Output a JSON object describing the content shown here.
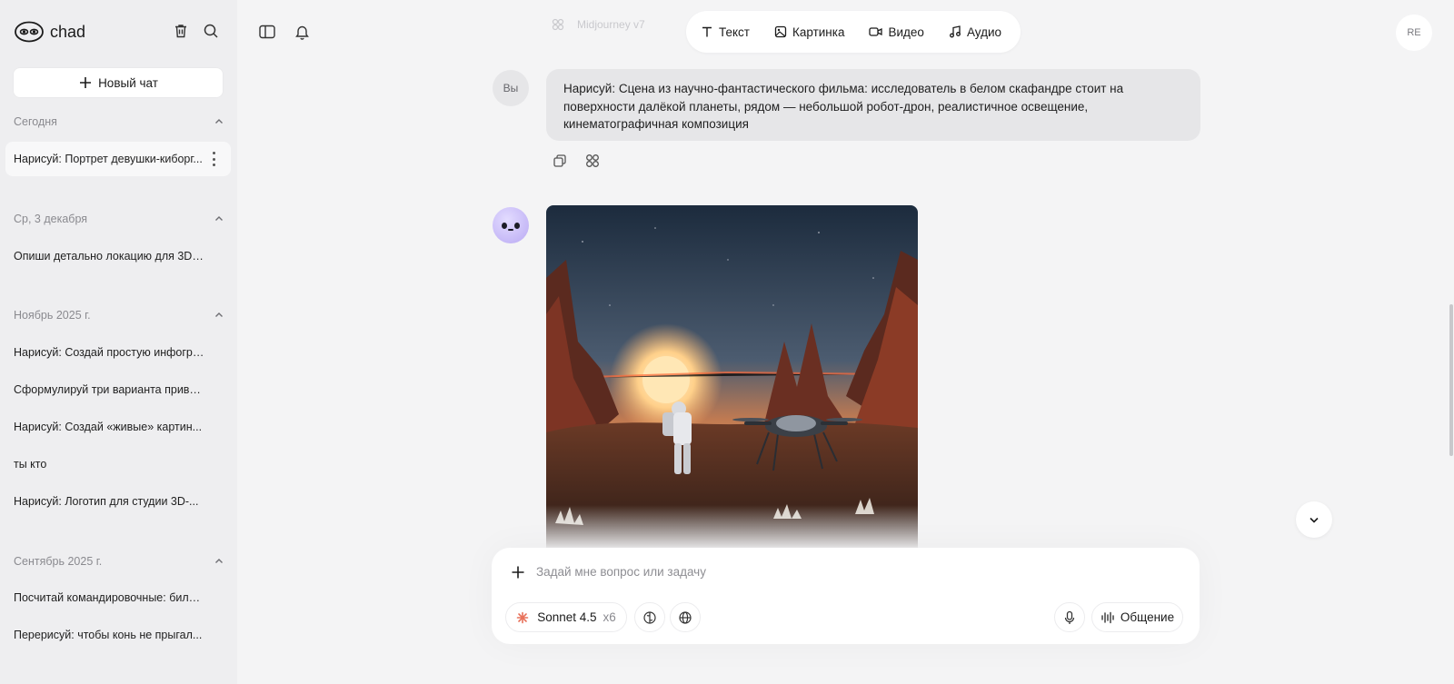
{
  "app": {
    "name": "chad"
  },
  "sidebar": {
    "new_chat_label": "Новый чат",
    "sections": [
      {
        "title": "Сегодня",
        "items": [
          "Нарисуй: Портрет девушки-киборг..."
        ]
      },
      {
        "title": "Ср, 3 декабря",
        "items": [
          "Опиши детально локацию для 3D-..."
        ]
      },
      {
        "title": "Ноябрь 2025 г.",
        "items": [
          "Нарисуй: Создай простую инфогра...",
          "Сформулируй три варианта привет...",
          "Нарисуй: Создай «живые» картин...",
          "ты кто",
          "Нарисуй: Логотип для студии 3D-..."
        ]
      },
      {
        "title": "Сентябрь 2025 г.",
        "items": [
          "Посчитай командировочные: билет...",
          "Перерисуй: чтобы конь не прыгал..."
        ]
      }
    ]
  },
  "topbar": {
    "ghost_model": "Midjourney v7",
    "modes": [
      {
        "label": "Текст",
        "icon": "text-icon"
      },
      {
        "label": "Картинка",
        "icon": "image-icon"
      },
      {
        "label": "Видео",
        "icon": "video-icon"
      },
      {
        "label": "Аудио",
        "icon": "audio-icon"
      }
    ],
    "user_initials": "RE"
  },
  "conversation": {
    "user_avatar_label": "Вы",
    "user_message": "Нарисуй: Сцена из научно-фантастического фильма: исследователь в белом скафандре стоит на поверхности далёкой планеты, рядом — небольшой робот-дрон, реалистичное освещение, кинематографичная композиция"
  },
  "composer": {
    "placeholder": "Задай мне вопрос или задачу",
    "model_name": "Sonnet 4.5",
    "model_multiplier": "x6",
    "voice_label": "Общение"
  },
  "colors": {
    "sidebar_bg": "#eeeef0",
    "main_bg": "#f4f4f5",
    "bubble_bg": "#e6e6e8",
    "model_accent": "#e8715a"
  }
}
